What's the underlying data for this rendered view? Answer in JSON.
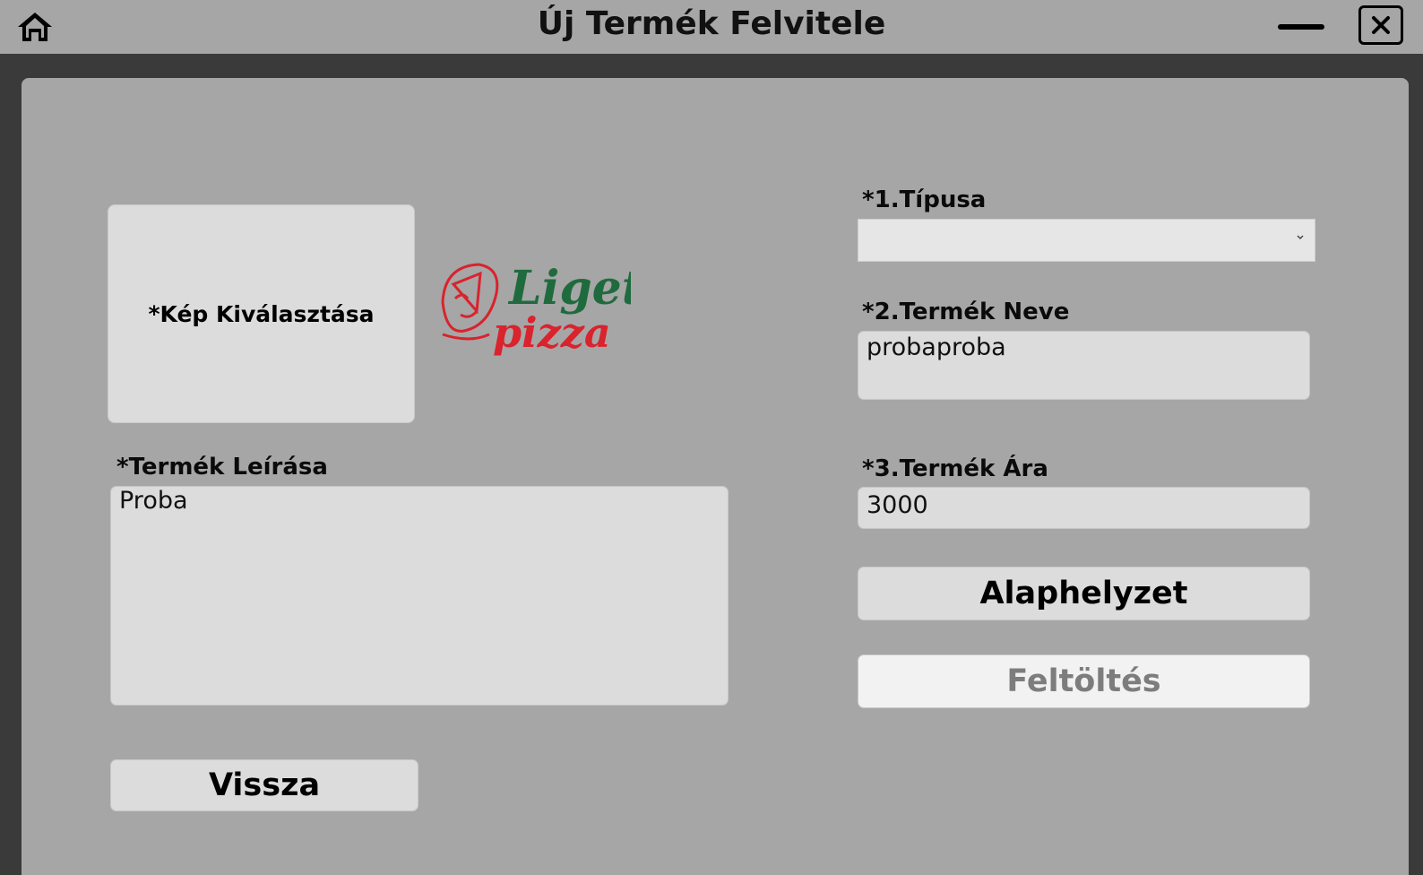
{
  "window": {
    "title": "Új Termék Felvitele",
    "home_icon": "home-icon",
    "minimize_icon": "minimize-icon",
    "close_icon": "close-icon"
  },
  "image_picker": {
    "label": "*Kép Kiválasztása"
  },
  "logo": {
    "line1": "Liget",
    "line2": "pizza",
    "colors": {
      "green": "#1f6b3d",
      "red": "#d9232d"
    }
  },
  "description": {
    "label": "*Termék Leírása",
    "value": "Proba"
  },
  "type_field": {
    "label": "*1.Típusa",
    "value": ""
  },
  "name_field": {
    "label": "*2.Termék Neve",
    "value": "probaproba"
  },
  "price_field": {
    "label": "*3.Termék Ára",
    "value": "3000"
  },
  "buttons": {
    "reset": "Alaphelyzet",
    "upload": "Feltöltés",
    "back": "Vissza"
  }
}
